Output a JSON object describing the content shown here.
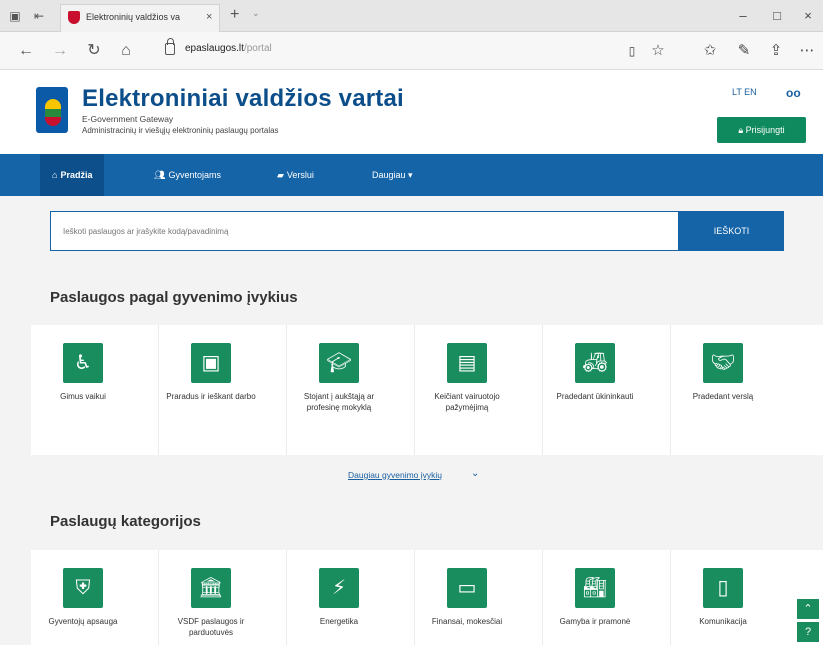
{
  "browser": {
    "tab_title": "Elektroninių valdžios va",
    "tab_close": "×",
    "new_tab": "+",
    "tab_chevron": "⌄",
    "url_host": "epaslaugos.lt",
    "url_path": "/portal",
    "window_controls": {
      "minimize": "–",
      "maximize": "□",
      "close": "×"
    }
  },
  "header": {
    "title": "Elektroniniai valdžios vartai",
    "subtitle": "E-Government Gateway",
    "tagline": "Administracinių ir viešųjų elektroninių paslaugų portalas",
    "languages": "LT EN",
    "login_label": "Prisijungti",
    "login_icon": "lock-icon"
  },
  "nav": {
    "items": [
      {
        "label": "Pradžia",
        "icon": "home-icon"
      },
      {
        "label": "Gyventojams",
        "icon": "people-icon"
      },
      {
        "label": "Verslui",
        "icon": "briefcase-icon"
      },
      {
        "label": "Daugiau ▾",
        "icon": ""
      }
    ]
  },
  "search": {
    "placeholder": "Ieškoti paslaugos ar įrašykite kodą/pavadinimą",
    "button_label": "IEŠKOTI"
  },
  "life_events": {
    "title": "Paslaugos pagal gyvenimo įvykius",
    "items": [
      {
        "label": "Gimus vaikui",
        "icon": "baby-carriage-icon"
      },
      {
        "label": "Praradus ir ieškant darbo",
        "icon": "id-card-icon"
      },
      {
        "label": "Stojant į aukštąją ar profesinę mokyklą",
        "icon": "graduation-cap-icon"
      },
      {
        "label": "Keičiant vairuotojo pažymėjimą",
        "icon": "license-card-icon"
      },
      {
        "label": "Pradedant ūkininkauti",
        "icon": "tractor-icon"
      },
      {
        "label": "Pradedant verslą",
        "icon": "handshake-icon"
      }
    ],
    "more_link": "Daugiau gyvenimo įvykių"
  },
  "categories": {
    "title": "Paslaugų kategorijos",
    "items": [
      {
        "label": "Gyventojų apsauga",
        "icon": "shield-icon"
      },
      {
        "label": "VSDF paslaugos ir parduotuvės",
        "icon": "bank-icon"
      },
      {
        "label": "Energetika",
        "icon": "energy-icon"
      },
      {
        "label": "Finansai, mokesčiai",
        "icon": "money-icon"
      },
      {
        "label": "Gamyba ir pramonė",
        "icon": "factory-icon"
      },
      {
        "label": "Komunikacija",
        "icon": "phone-icon"
      }
    ]
  },
  "colors": {
    "primary_blue": "#1664a8",
    "accent_green": "#1a8d5f",
    "title_blue": "#0b4e8a"
  }
}
